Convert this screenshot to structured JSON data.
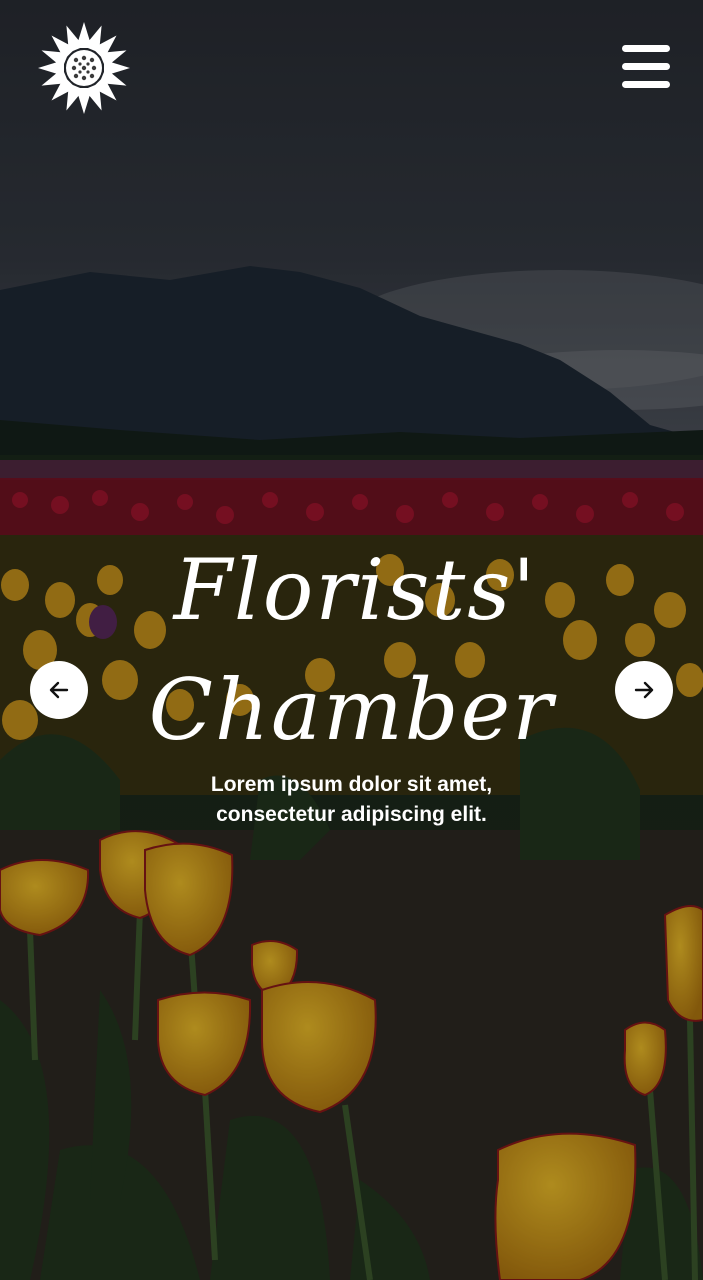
{
  "header": {
    "logo_icon": "sunflower-icon",
    "menu_icon": "hamburger-menu-icon"
  },
  "hero": {
    "title_line1": "Florists'",
    "title_line2": "Chamber",
    "subtitle_line1": "Lorem ipsum dolor sit amet,",
    "subtitle_line2": "consectetur adipiscing elit.",
    "prev_icon": "arrow-left-icon",
    "next_icon": "arrow-right-icon",
    "background": "tulip-field-mountain-photo"
  },
  "colors": {
    "text": "#ffffff",
    "sky": "#2b3038",
    "mountain": "#1f2a36",
    "tulip_yellow": "#d9a21a",
    "tulip_red": "#8e1327"
  }
}
